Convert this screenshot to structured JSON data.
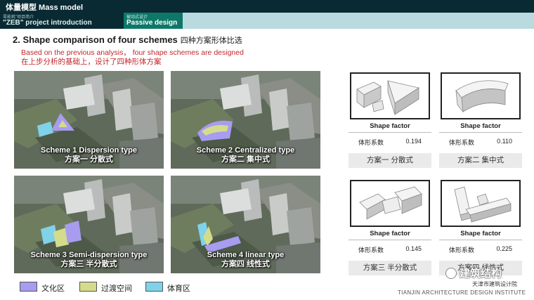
{
  "header": {
    "title": "体量模型 Mass model",
    "tab1_small": "零能耗\"项目简介",
    "tab1_label": "\"ZEB\"  project introduction",
    "tab2_small": "被动式设计",
    "tab2_label": "Passive design"
  },
  "section": {
    "heading_en": "2. Shape comparison of four schemes",
    "heading_cn": "四种方案形体比选",
    "sub_en": "Based on the previous analysis， four shape schemes are designed",
    "sub_cn": "在上步分析的基础上，设计了四种形体方案"
  },
  "schemes": [
    {
      "caption_en": "Scheme 1  Dispersion type",
      "caption_cn": "方案一  分散式"
    },
    {
      "caption_en": "Scheme 2  Centralized type",
      "caption_cn": "方案二  集中式"
    },
    {
      "caption_en": "Scheme 3  Semi-dispersion type",
      "caption_cn": "方案三  半分散式"
    },
    {
      "caption_en": "Scheme 4  linear type",
      "caption_cn": "方案四 线性式"
    }
  ],
  "shape_cards": [
    {
      "label": "Shape factor",
      "key": "体形系数",
      "value": "0.194",
      "name": "方案一  分散式"
    },
    {
      "label": "Shape factor",
      "key": "体形系数",
      "value": "0.110",
      "name": "方案二  集中式"
    },
    {
      "label": "Shape factor",
      "key": "体形系数",
      "value": "0.145",
      "name": "方案三  半分散式"
    },
    {
      "label": "Shape factor",
      "key": "体形系数",
      "value": "0.225",
      "name": "方案四  线性式"
    }
  ],
  "legend": [
    {
      "label": "文化区",
      "color": "#a79cf0"
    },
    {
      "label": "过渡空间",
      "color": "#d4dc8c"
    },
    {
      "label": "体育区",
      "color": "#7fd2ea"
    }
  ],
  "footer": {
    "watermark": "建筑结构",
    "institute_cn": "天津市建筑设计院",
    "institute_en": "TIANJIN ARCHITECTURE DESIGN INSTITUTE"
  },
  "colors": {
    "header_dark": "#0a2a33",
    "header_light": "#b9dadf",
    "tab_active": "#0e7868",
    "accent_red": "#c0272d"
  }
}
